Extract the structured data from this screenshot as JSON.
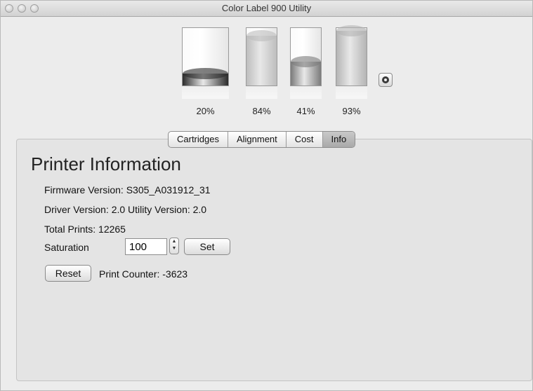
{
  "window": {
    "title": "Color Label 900 Utility"
  },
  "cartridges": [
    {
      "percent": 20,
      "label": "20%",
      "ink_color": "#2b2b2b"
    },
    {
      "percent": 84,
      "label": "84%",
      "ink_color": "#bdbdbd"
    },
    {
      "percent": 41,
      "label": "41%",
      "ink_color": "#7b7b7b"
    },
    {
      "percent": 93,
      "label": "93%",
      "ink_color": "#b4b4b4"
    }
  ],
  "tabs": [
    {
      "label": "Cartridges"
    },
    {
      "label": "Alignment"
    },
    {
      "label": "Cost"
    },
    {
      "label": "Info"
    }
  ],
  "info": {
    "heading": "Printer Information",
    "firmware": "Firmware Version: S305_A031912_31",
    "driver": "Driver Version: 2.0 Utility Version: 2.0",
    "total_prints": "Total Prints: 12265",
    "saturation_label": "Saturation",
    "saturation_value": "100",
    "set_label": "Set",
    "reset_label": "Reset",
    "print_counter": "Print Counter: -3623"
  },
  "icons": {
    "refresh": "refresh-icon",
    "stepper": "stepper-arrows-icon"
  }
}
